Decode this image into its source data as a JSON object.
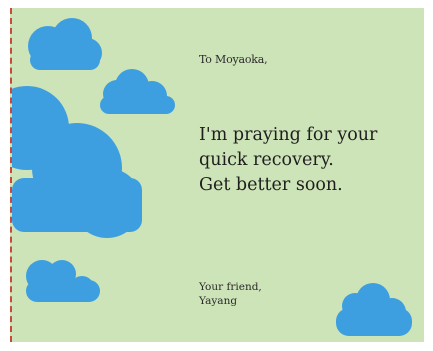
{
  "card": {
    "greeting": "To Moyaoka,",
    "message_lines": [
      "I'm praying for your",
      "quick recovery.",
      "Get better soon."
    ],
    "closing_line": "Your friend,",
    "signature": "Yayang"
  },
  "colors": {
    "background": "#cde3b8",
    "cloud": "#3d9fe0",
    "border": "#c94a3a",
    "text": "#1e1e1e"
  }
}
